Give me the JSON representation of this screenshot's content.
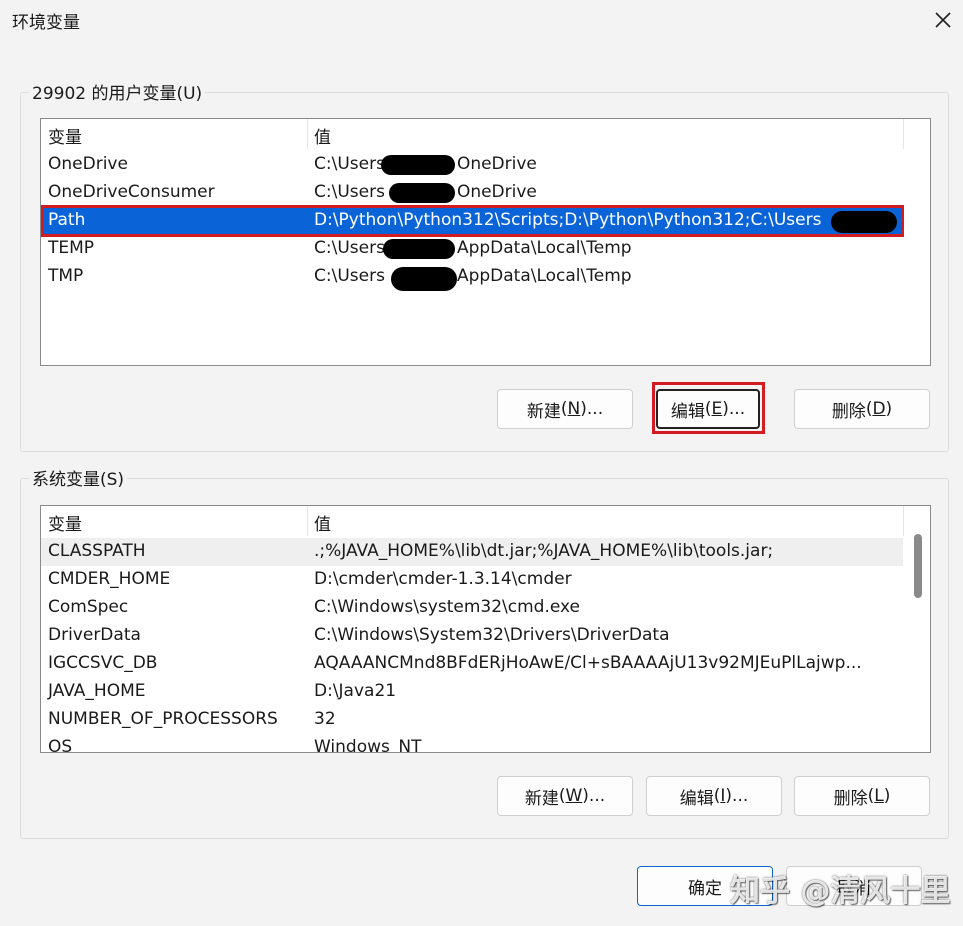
{
  "window": {
    "title": "环境变量"
  },
  "user_vars": {
    "group_label": "29902 的用户变量(U)",
    "header": [
      "变量",
      "值"
    ],
    "rows": [
      {
        "name": "OneDrive",
        "value_prefix": "C:\\Users",
        "value_suffix": "OneDrive"
      },
      {
        "name": "OneDriveConsumer",
        "value_prefix": "C:\\Users",
        "value_suffix": "OneDrive"
      },
      {
        "name": "Path",
        "value_prefix": "D:\\Python\\Python312\\Scripts;D:\\Python\\Python312;C:\\Users",
        "value_suffix": ""
      },
      {
        "name": "TEMP",
        "value_prefix": "C:\\Users",
        "value_suffix": "AppData\\Local\\Temp"
      },
      {
        "name": "TMP",
        "value_prefix": "C:\\Users",
        "value_suffix": "AppData\\Local\\Temp"
      }
    ],
    "buttons": {
      "new": {
        "label": "新建",
        "key": "N"
      },
      "edit": {
        "label": "编辑",
        "key": "E"
      },
      "delete": {
        "label": "删除",
        "key": "D"
      }
    }
  },
  "system_vars": {
    "group_label": "系统变量(S)",
    "header": [
      "变量",
      "值"
    ],
    "rows": [
      {
        "name": "CLASSPATH",
        "value": ".;%JAVA_HOME%\\lib\\dt.jar;%JAVA_HOME%\\lib\\tools.jar;"
      },
      {
        "name": "CMDER_HOME",
        "value": "D:\\cmder\\cmder-1.3.14\\cmder"
      },
      {
        "name": "ComSpec",
        "value": "C:\\Windows\\system32\\cmd.exe"
      },
      {
        "name": "DriverData",
        "value": "C:\\Windows\\System32\\Drivers\\DriverData"
      },
      {
        "name": "IGCCSVC_DB",
        "value": "AQAAANCMnd8BFdERjHoAwE/Cl+sBAAAAjU13v92MJEuPlLajwp..."
      },
      {
        "name": "JAVA_HOME",
        "value": "D:\\Java21"
      },
      {
        "name": "NUMBER_OF_PROCESSORS",
        "value": "32"
      },
      {
        "name": "OS",
        "value": "Windows_NT"
      }
    ],
    "buttons": {
      "new": {
        "label": "新建",
        "key": "W"
      },
      "edit": {
        "label": "编辑",
        "key": "I"
      },
      "delete": {
        "label": "删除",
        "key": "L"
      }
    }
  },
  "footer": {
    "ok_label": "确定",
    "cancel_label": "取消"
  },
  "watermark": "知乎 @清风十里",
  "colors": {
    "selection": "#0a64d8",
    "highlight_box": "#d21c22",
    "background": "#f3f3f3"
  }
}
